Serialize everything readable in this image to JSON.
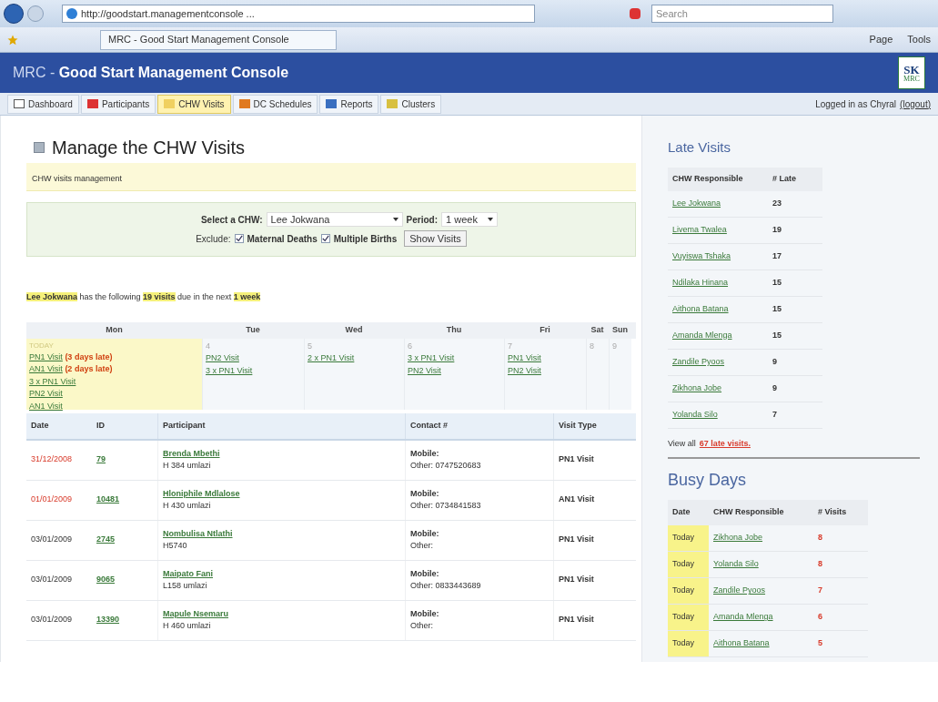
{
  "browser": {
    "address": "http://goodstart.managementconsole ...",
    "search_placeholder": "Search",
    "tab_title": "MRC - Good Start Management Console",
    "toolbar": [
      "Page",
      "Tools"
    ]
  },
  "header": {
    "prefix": "MRC - ",
    "title": "Good Start Management Console",
    "logo_top": "SK",
    "logo_bottom": "MRC"
  },
  "nav": {
    "tabs": [
      {
        "label": "Dashboard",
        "selected": false
      },
      {
        "label": "Participants",
        "selected": false
      },
      {
        "label": "CHW Visits",
        "selected": true
      },
      {
        "label": "DC Schedules",
        "selected": false
      },
      {
        "label": "Reports",
        "selected": false
      },
      {
        "label": "Clusters",
        "selected": false
      }
    ],
    "login_text": "Logged in as Chyral",
    "logout": "(logout)"
  },
  "page": {
    "title": "Manage the CHW Visits",
    "subtitle": "CHW visits management"
  },
  "filter": {
    "chw_label": "Select a CHW:",
    "chw_value": "Lee Jokwana",
    "period_label": "Period:",
    "period_value": "1 week",
    "exclude_label": "Exclude:",
    "options": [
      {
        "label": "Maternal Deaths",
        "checked": true
      },
      {
        "label": "Multiple Births",
        "checked": true
      }
    ],
    "button": "Show Visits"
  },
  "summary": "**Lee Jokwana** has the following **19 visits** due in the next **1 week**",
  "calendar": {
    "days": [
      {
        "label": "Mon",
        "date": "TODAY",
        "today": true,
        "visits": [
          {
            "text": "PN1 Visit",
            "late": "(3 days late)"
          },
          {
            "text": "AN1 Visit",
            "late": "(2 days late)"
          },
          {
            "text": "3 x PN1 Visit"
          },
          {
            "text": "PN2 Visit"
          },
          {
            "text": "AN1 Visit"
          }
        ]
      },
      {
        "label": "Tue",
        "date": "4",
        "today": false,
        "visits": [
          {
            "text": "PN2 Visit"
          },
          {
            "text": "3 x PN1 Visit"
          }
        ]
      },
      {
        "label": "Wed",
        "date": "5",
        "today": false,
        "visits": [
          {
            "text": "2 x PN1 Visit"
          }
        ]
      },
      {
        "label": "Thu",
        "date": "6",
        "today": false,
        "visits": [
          {
            "text": "3 x PN1 Visit"
          },
          {
            "text": "PN2 Visit"
          }
        ]
      },
      {
        "label": "Fri",
        "date": "7",
        "today": false,
        "visits": [
          {
            "text": "PN1 Visit"
          },
          {
            "text": "PN2 Visit"
          }
        ]
      },
      {
        "label": "Sat",
        "date": "8",
        "today": false
      },
      {
        "label": "Sun",
        "date": "9",
        "today": false
      }
    ]
  },
  "table": {
    "columns": [
      "Date",
      "ID",
      "Participant",
      "Contact #",
      "Visit Type"
    ],
    "rows": [
      {
        "date": "31/12/2008",
        "overdue": true,
        "id": "79",
        "name": "Brenda Mbethi",
        "address": "H 384 umlazi",
        "mobile": "Mobile:",
        "other": "Other: 0747520683",
        "visit_type": "PN1 Visit"
      },
      {
        "date": "01/01/2009",
        "overdue": true,
        "id": "10481",
        "name": "Hloniphile Mdlalose",
        "address": "H 430 umlazi",
        "mobile": "Mobile:",
        "other": "Other: 0734841583",
        "visit_type": "AN1 Visit"
      },
      {
        "date": "03/01/2009",
        "overdue": false,
        "id": "2745",
        "name": "Nombulisa Ntlathi",
        "address": "H5740",
        "mobile": "Mobile:",
        "other": "Other:",
        "visit_type": "PN1 Visit"
      },
      {
        "date": "03/01/2009",
        "overdue": false,
        "id": "9065",
        "name": "Maipato Fani",
        "address": "L158 umlazi",
        "mobile": "Mobile:",
        "other": "Other: 0833443689",
        "visit_type": "PN1 Visit"
      },
      {
        "date": "03/01/2009",
        "overdue": false,
        "id": "13390",
        "name": "Mapule Nsemaru",
        "address": "H 460 umlazi",
        "mobile": "Mobile:",
        "other": "Other:",
        "visit_type": "PN1 Visit"
      }
    ]
  },
  "late_visits": {
    "title": "Late Visits",
    "columns": [
      "CHW Responsible",
      "# Late"
    ],
    "rows": [
      {
        "name": "Lee Jokwana",
        "count": "23"
      },
      {
        "name": "Livema Twalea",
        "count": "19"
      },
      {
        "name": "Vuyiswa Tshaka",
        "count": "17"
      },
      {
        "name": "Ndilaka Hinana",
        "count": "15"
      },
      {
        "name": "Aithona Batana",
        "count": "15"
      },
      {
        "name": "Amanda Mlenga",
        "count": "15"
      },
      {
        "name": "Zandile Pyoos",
        "count": "9"
      },
      {
        "name": "Zikhona Jobe",
        "count": "9"
      },
      {
        "name": "Yolanda Silo",
        "count": "7"
      }
    ],
    "footer_prefix": "View all",
    "footer_link": "67 late visits."
  },
  "busy_days": {
    "title": "Busy Days",
    "columns": [
      "Date",
      "CHW Responsible",
      "# Visits"
    ],
    "rows": [
      {
        "date": "Today",
        "name": "Zikhona Jobe",
        "count": "8"
      },
      {
        "date": "Today",
        "name": "Yolanda Silo",
        "count": "8"
      },
      {
        "date": "Today",
        "name": "Zandile Pyoos",
        "count": "7"
      },
      {
        "date": "Today",
        "name": "Amanda Mlenga",
        "count": "6"
      },
      {
        "date": "Today",
        "name": "Aithona Batana",
        "count": "5"
      }
    ]
  }
}
